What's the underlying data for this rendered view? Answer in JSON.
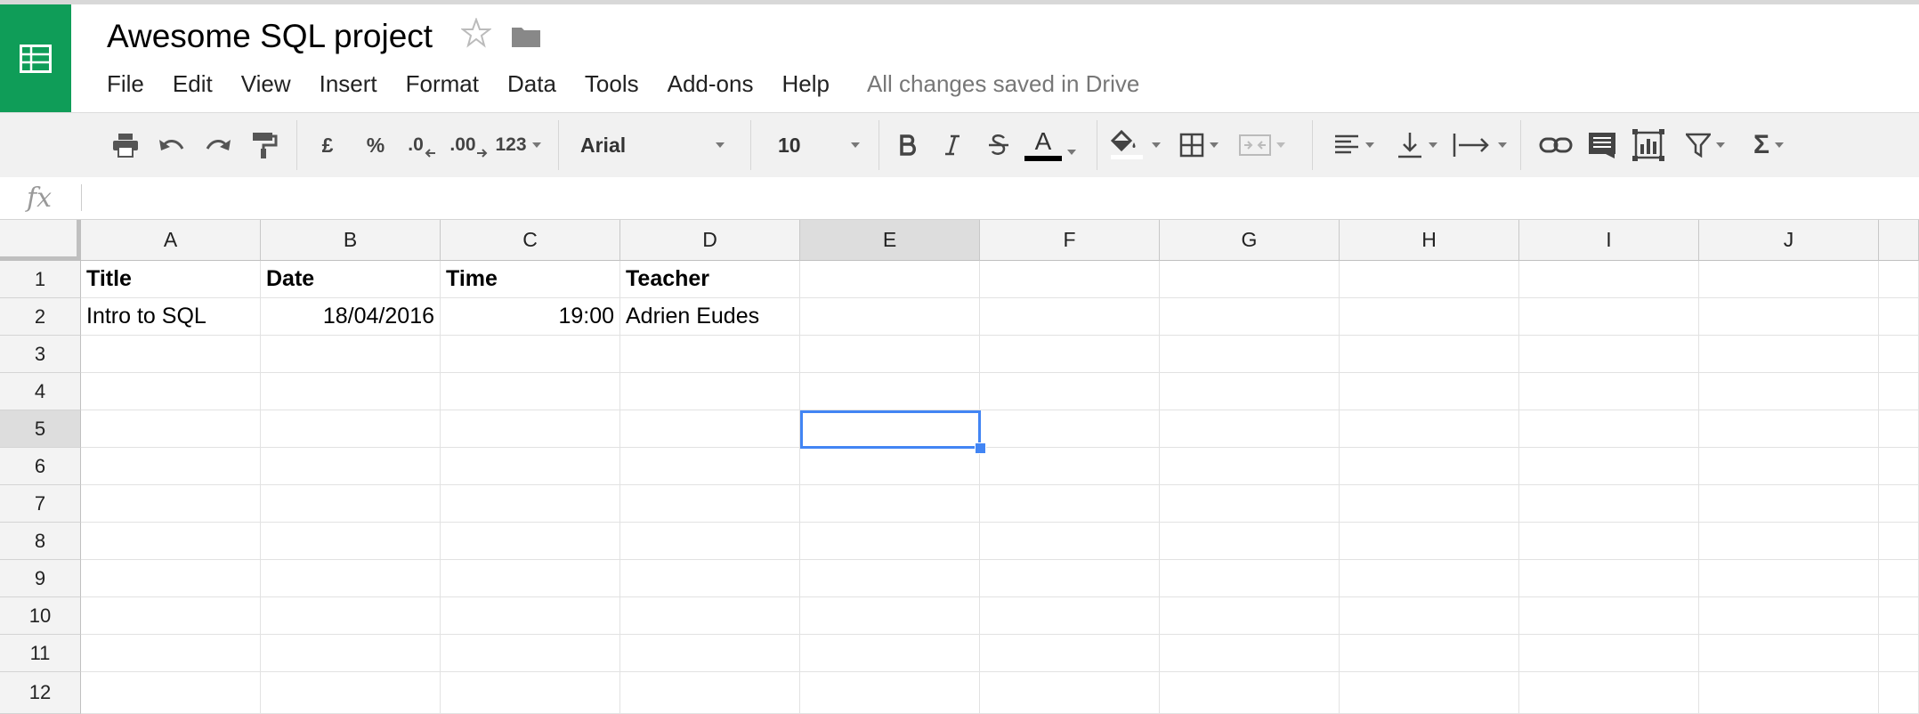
{
  "app": {
    "title": "Awesome SQL project",
    "status": "All changes saved in Drive",
    "brand_color": "#0f9d58",
    "selection_color": "#4285f4"
  },
  "menu": [
    "File",
    "Edit",
    "View",
    "Insert",
    "Format",
    "Data",
    "Tools",
    "Add-ons",
    "Help"
  ],
  "toolbar": {
    "currency": "£",
    "percent": "%",
    "decrease_decimals": ".0",
    "increase_decimals": ".00",
    "more_formats": "123",
    "font": "Arial",
    "font_size": "10",
    "text_color_letter": "A",
    "sum": "Σ",
    "icons": [
      "print-icon",
      "undo-icon",
      "redo-icon",
      "paint-format-icon",
      "bold-icon",
      "italic-icon",
      "strikethrough-icon",
      "text-color-icon",
      "fill-color-icon",
      "borders-icon",
      "merge-cells-icon",
      "align-left-icon",
      "vertical-align-icon",
      "text-wrap-icon",
      "link-icon",
      "comment-icon",
      "chart-icon",
      "filter-icon",
      "functions-icon"
    ]
  },
  "formula_bar": {
    "label": "fx",
    "value": ""
  },
  "sheet": {
    "columns": [
      "A",
      "B",
      "C",
      "D",
      "E",
      "F",
      "G",
      "H",
      "I",
      "J"
    ],
    "rows": [
      "1",
      "2",
      "3",
      "4",
      "5",
      "6",
      "7",
      "8",
      "9",
      "10",
      "11",
      "12"
    ],
    "cells": {
      "A1": "Title",
      "B1": "Date",
      "C1": "Time",
      "D1": "Teacher",
      "A2": "Intro to SQL",
      "B2": "18/04/2016",
      "C2": "19:00",
      "D2": "Adrien Eudes"
    },
    "selected_cell": "E5"
  }
}
